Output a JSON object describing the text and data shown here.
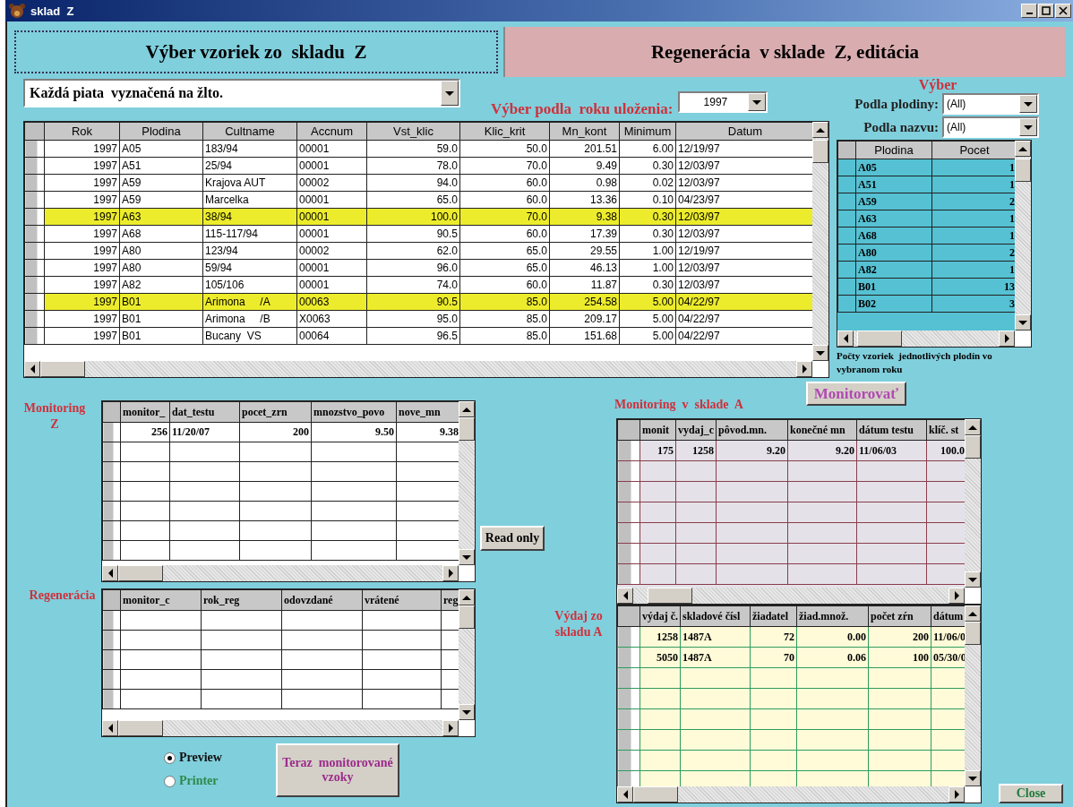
{
  "window": {
    "title": "sklad  Z"
  },
  "tabs": [
    {
      "label": "Výber vzoriek zo  skladu  Z",
      "selected": true
    },
    {
      "label": "Regenerácia  v sklade  Z, editácia",
      "selected": false
    }
  ],
  "filter_combo": {
    "value": "Každá piata  vyznačená na žlto."
  },
  "year_filter": {
    "label": "Výber podla  roku uloženia:",
    "value": "1997"
  },
  "main_table": {
    "columns": [
      "Rok",
      "Plodina",
      "Cultname",
      "Accnum",
      "Vst_klic",
      "Klic_krit",
      "Mn_kont",
      "Minimum",
      "Datum"
    ],
    "rows": [
      {
        "cells": [
          "1997",
          "A05",
          "183/94",
          "00001",
          "59.0",
          "50.0",
          "201.51",
          "6.00",
          "12/19/97"
        ],
        "highlighted": false
      },
      {
        "cells": [
          "1997",
          "A51",
          "25/94",
          "00001",
          "78.0",
          "70.0",
          "9.49",
          "0.30",
          "12/03/97"
        ],
        "highlighted": false
      },
      {
        "cells": [
          "1997",
          "A59",
          "Krajova AUT",
          "00002",
          "94.0",
          "60.0",
          "0.98",
          "0.02",
          "12/03/97"
        ],
        "highlighted": false
      },
      {
        "cells": [
          "1997",
          "A59",
          "Marcelka",
          "00001",
          "65.0",
          "60.0",
          "13.36",
          "0.10",
          "04/23/97"
        ],
        "highlighted": false
      },
      {
        "cells": [
          "1997",
          "A63",
          "38/94",
          "00001",
          "100.0",
          "70.0",
          "9.38",
          "0.30",
          "12/03/97"
        ],
        "highlighted": true
      },
      {
        "cells": [
          "1997",
          "A68",
          "115-117/94",
          "00001",
          "90.5",
          "60.0",
          "17.39",
          "0.30",
          "12/03/97"
        ],
        "highlighted": false
      },
      {
        "cells": [
          "1997",
          "A80",
          "123/94",
          "00002",
          "62.0",
          "65.0",
          "29.55",
          "1.00",
          "12/19/97"
        ],
        "highlighted": false
      },
      {
        "cells": [
          "1997",
          "A80",
          "59/94",
          "00001",
          "96.0",
          "65.0",
          "46.13",
          "1.00",
          "12/03/97"
        ],
        "highlighted": false
      },
      {
        "cells": [
          "1997",
          "A82",
          "105/106",
          "00001",
          "74.0",
          "60.0",
          "11.87",
          "0.30",
          "12/03/97"
        ],
        "highlighted": false
      },
      {
        "cells": [
          "1997",
          "B01",
          "Arimona     /A",
          "00063",
          "90.5",
          "85.0",
          "254.58",
          "5.00",
          "04/22/97"
        ],
        "highlighted": true
      },
      {
        "cells": [
          "1997",
          "B01",
          "Arimona     /B",
          "X0063",
          "95.0",
          "85.0",
          "209.17",
          "5.00",
          "04/22/97"
        ],
        "highlighted": false
      },
      {
        "cells": [
          "1997",
          "B01",
          "Bucany  VS",
          "00064",
          "96.5",
          "85.0",
          "151.68",
          "5.00",
          "04/22/97"
        ],
        "highlighted": false
      }
    ]
  },
  "selection_panel": {
    "title": "Výber",
    "filters": [
      {
        "label": "Podla plodiny:",
        "value": "(All)"
      },
      {
        "label": "Podla nazvu:",
        "value": "(All)"
      }
    ],
    "table": {
      "columns": [
        "Plodina",
        "Pocet"
      ],
      "rows": [
        [
          "A05",
          "1"
        ],
        [
          "A51",
          "1"
        ],
        [
          "A59",
          "2"
        ],
        [
          "A63",
          "1"
        ],
        [
          "A68",
          "1"
        ],
        [
          "A80",
          "2"
        ],
        [
          "A82",
          "1"
        ],
        [
          "B01",
          "13"
        ],
        [
          "B02",
          "3"
        ]
      ]
    },
    "caption": "Počty vzoriek  jednotlivých plodín vo vybranom roku"
  },
  "monitoring_z": {
    "label": "Monitoring Z",
    "table": {
      "columns": [
        "monitor_",
        "dat_testu",
        "pocet_zrn",
        "mnozstvo_povo",
        "nove_mn"
      ],
      "rows": [
        [
          "256",
          "11/20/07",
          "200",
          "9.50",
          "9.38"
        ]
      ]
    }
  },
  "read_only_button": "Read only",
  "regeneracia": {
    "label": "Regenerácia",
    "table": {
      "columns": [
        "monitor_c",
        "rok_reg",
        "odovzdané",
        "vrátené",
        "reg"
      ]
    }
  },
  "output_options": [
    {
      "label": "Preview",
      "selected": true
    },
    {
      "label": "Printer",
      "selected": false
    }
  ],
  "monitored_button": "Teraz  monitorované vzoky",
  "monitor_button": "Monitorovať",
  "monitoring_a": {
    "label": "Monitoring  v  sklade  A",
    "table": {
      "columns": [
        "monit",
        "vydaj_c",
        "pôvod.mn.",
        "konečné mn",
        "dátum testu",
        "klíč. st"
      ],
      "rows": [
        [
          "175",
          "1258",
          "9.20",
          "9.20",
          "11/06/03",
          "100.0"
        ]
      ]
    }
  },
  "vydaj_a": {
    "label": "Výdaj  zo skladu  A",
    "table": {
      "columns": [
        "výdaj č.",
        "skladové čísl",
        "žiadatel",
        "žiad.množ.",
        "počet zŕn",
        "dátum"
      ],
      "rows": [
        [
          "1258",
          "1487A",
          "72",
          "0.00",
          "200",
          "11/06/0"
        ],
        [
          "5050",
          "1487A",
          "70",
          "0.06",
          "100",
          "05/30/0"
        ]
      ]
    }
  },
  "close_button": "Close"
}
